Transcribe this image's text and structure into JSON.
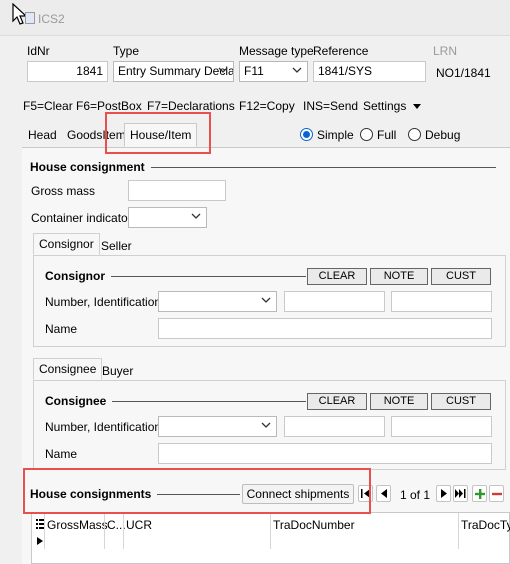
{
  "window": {
    "title": "ICS2",
    "icon": "app-window-icon",
    "cursor": "mouse-pointer-icon"
  },
  "header": {
    "idnr_label": "IdNr",
    "idnr_value": "1841",
    "type_label": "Type",
    "type_value": "Entry Summary Decla",
    "msgtype_label": "Message type",
    "msgtype_value": "F11",
    "reference_label": "Reference",
    "reference_value": "1841/SYS",
    "lrn_label": "LRN",
    "lrn_value": "NO1/1841"
  },
  "toolbar": {
    "clear": "F5=Clear",
    "postbox": "F6=PostBox",
    "declarations": "F7=Declarations",
    "copy": "F12=Copy",
    "send": "INS=Send",
    "settings": "Settings"
  },
  "tabs": {
    "head": "Head",
    "goodsitem": "GoodsItem",
    "houseitem": "House/Item"
  },
  "view_mode": {
    "simple": "Simple",
    "full": "Full",
    "debug": "Debug",
    "selected": "Simple"
  },
  "house_consignment": {
    "title": "House consignment",
    "gross_mass_label": "Gross mass",
    "gross_mass_value": "",
    "container_label": "Container indicator",
    "container_value": ""
  },
  "consignor_block": {
    "tab_active": "Consignor",
    "tab_other": "Seller",
    "title": "Consignor",
    "clear_btn": "CLEAR",
    "note_btn": "NOTE",
    "cust_btn": "CUST",
    "number_label": "Number, Identification",
    "name_label": "Name"
  },
  "consignee_block": {
    "tab_active": "Consignee",
    "tab_other": "Buyer",
    "title": "Consignee",
    "clear_btn": "CLEAR",
    "note_btn": "NOTE",
    "cust_btn": "CUST",
    "number_label": "Number, Identification",
    "name_label": "Name"
  },
  "house_consignments": {
    "title": "House consignments",
    "connect_btn": "Connect shipments",
    "pager": "1 of 1",
    "columns": [
      "GrossMass",
      "C...",
      "UCR",
      "TraDocNumber",
      "TraDocTy"
    ]
  },
  "colors": {
    "highlight": "#e8504d",
    "accent": "#0a64d1",
    "add": "#2e9a2e",
    "remove": "#d23b3b"
  }
}
